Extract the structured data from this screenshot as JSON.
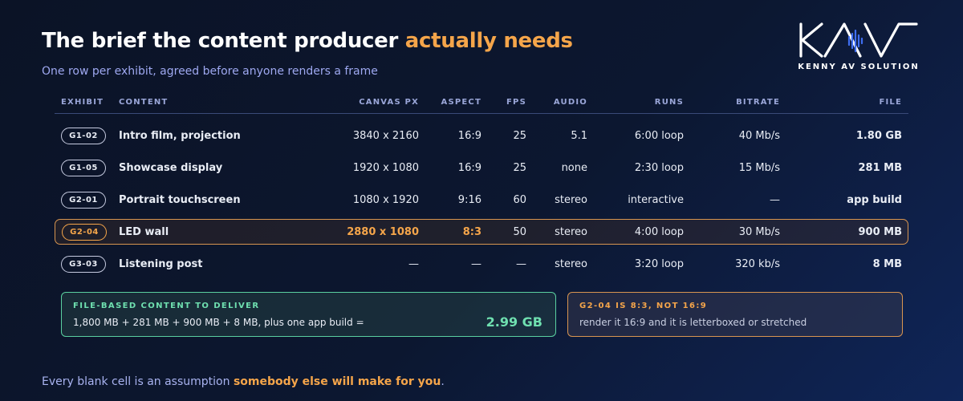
{
  "header": {
    "title_main": "The brief the content producer ",
    "title_accent": "actually needs",
    "subtitle": "One row per exhibit, agreed before anyone renders a frame"
  },
  "logo": {
    "text": "KENNY AV SOLUTION",
    "colors": {
      "mark": "#ffffff",
      "wave": "#3f6ef0"
    }
  },
  "table": {
    "headers": {
      "exhibit": "EXHIBIT",
      "content": "CONTENT",
      "canvas": "CANVAS PX",
      "aspect": "ASPECT",
      "fps": "FPS",
      "audio": "AUDIO",
      "runs": "RUNS",
      "bitrate": "BITRATE",
      "file": "FILE"
    },
    "rows": [
      {
        "exhibit": "G1-02",
        "content": "Intro film, projection",
        "canvas": "3840 x 2160",
        "aspect": "16:9",
        "fps": "25",
        "audio": "5.1",
        "runs": "6:00 loop",
        "bitrate": "40 Mb/s",
        "file": "1.80 GB",
        "highlight": false
      },
      {
        "exhibit": "G1-05",
        "content": "Showcase display",
        "canvas": "1920 x 1080",
        "aspect": "16:9",
        "fps": "25",
        "audio": "none",
        "runs": "2:30 loop",
        "bitrate": "15 Mb/s",
        "file": "281 MB",
        "highlight": false
      },
      {
        "exhibit": "G2-01",
        "content": "Portrait touchscreen",
        "canvas": "1080 x 1920",
        "aspect": "9:16",
        "fps": "60",
        "audio": "stereo",
        "runs": "interactive",
        "bitrate": "—",
        "file": "app build",
        "highlight": false
      },
      {
        "exhibit": "G2-04",
        "content": "LED wall",
        "canvas": "2880 x 1080",
        "aspect": "8:3",
        "fps": "50",
        "audio": "stereo",
        "runs": "4:00 loop",
        "bitrate": "30 Mb/s",
        "file": "900 MB",
        "highlight": true
      },
      {
        "exhibit": "G3-03",
        "content": "Listening post",
        "canvas": "—",
        "aspect": "—",
        "fps": "—",
        "audio": "stereo",
        "runs": "3:20 loop",
        "bitrate": "320 kb/s",
        "file": "8 MB",
        "highlight": false
      }
    ]
  },
  "summary": {
    "title": "FILE-BASED CONTENT TO DELIVER",
    "text": "1,800 MB + 281 MB + 900 MB + 8 MB, plus one app build =",
    "total": "2.99 GB"
  },
  "warning": {
    "title": "G2-04 IS 8:3, NOT 16:9",
    "text": "render it 16:9 and it is letterboxed or stretched"
  },
  "footer": {
    "text_main": "Every blank cell is an assumption ",
    "text_accent": "somebody else will make for you",
    "text_end": "."
  },
  "colors": {
    "accent": "#f5a54a",
    "green": "#6fe0b0",
    "background": "#0b1326"
  }
}
